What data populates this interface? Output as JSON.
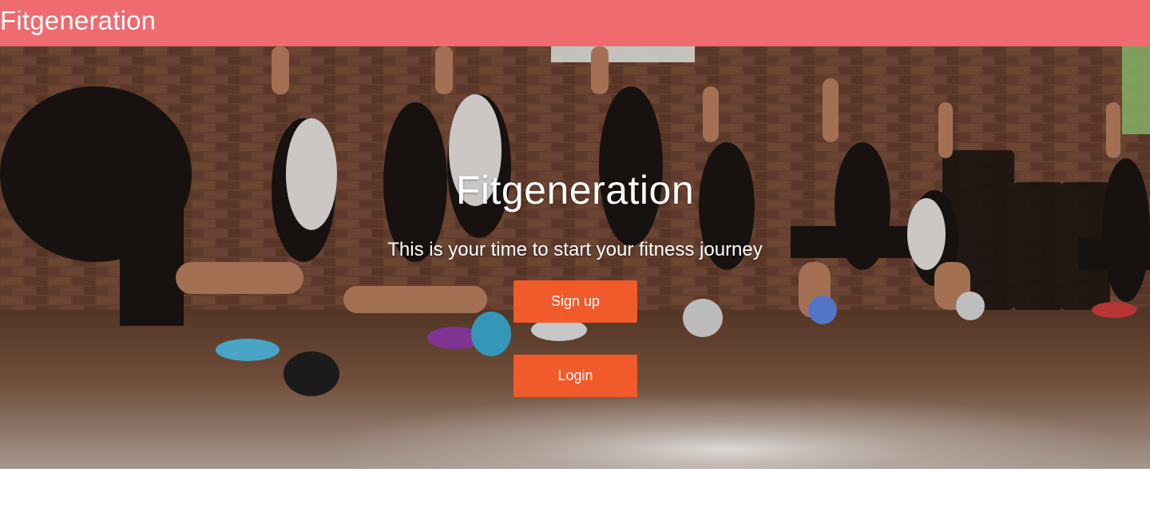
{
  "header": {
    "brand": "Fitgeneration"
  },
  "hero": {
    "title": "Fitgeneration",
    "subtitle": "This is your time to start your fitness journey",
    "image_description": "group-fitness-lunge-class-photo",
    "signup_label": "Sign up",
    "login_label": "Login"
  },
  "colors": {
    "header_bg": "#ef6b70",
    "button_bg": "#f15a2b",
    "text": "#ffffff"
  }
}
